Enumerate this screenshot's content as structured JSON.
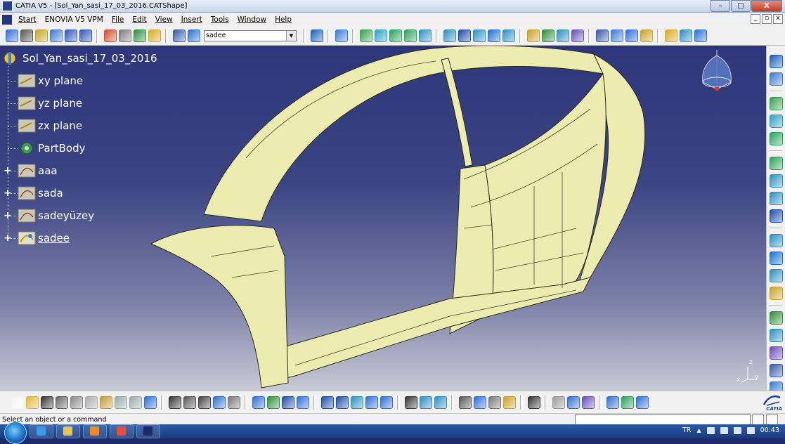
{
  "window": {
    "title": "CATIA V5 - [Sol_Yan_sasi_17_03_2016.CATShape]",
    "controls": [
      "–",
      "□",
      "X"
    ]
  },
  "menubar": {
    "items": [
      "Start",
      "ENOVIA V5 VPM",
      "File",
      "Edit",
      "View",
      "Insert",
      "Tools",
      "Window",
      "Help"
    ],
    "mdi_controls": [
      "_",
      "▫",
      "x"
    ]
  },
  "toolbar_top": {
    "layer_combo_value": "sadee",
    "icons": [
      {
        "name": "update-icon",
        "color": "#2f6fd6"
      },
      {
        "name": "cut-icon",
        "color": "#555"
      },
      {
        "name": "axis-system-icon",
        "color": "#c9a227"
      },
      {
        "name": "grid-icon",
        "color": "#3a7bd5"
      },
      {
        "name": "copy-icon",
        "color": "#2d57b8"
      },
      {
        "name": "paste-icon",
        "color": "#2d57b8"
      },
      {
        "name": "sketch-icon",
        "color": "#d04a2a"
      },
      {
        "name": "compass-icon",
        "color": "#7a7a7a"
      },
      {
        "name": "tree-icon",
        "color": "#2f8f3a"
      },
      {
        "name": "zoom-icon",
        "color": "#d8a820"
      },
      {
        "name": "list-icon",
        "color": "#3a5ba8"
      },
      {
        "name": "layer-icon",
        "color": "#2c6fd1"
      }
    ],
    "icons_right": [
      {
        "name": "text-icon",
        "color": "#1d5fb9"
      },
      {
        "name": "sketcher-icon",
        "color": "#3a7bd5"
      },
      {
        "name": "line-icon",
        "color": "#37a04a"
      },
      {
        "name": "spline-icon",
        "color": "#2aa1c9"
      },
      {
        "name": "surface-icon",
        "color": "#29a35b"
      },
      {
        "name": "sweep-icon",
        "color": "#29a35b"
      },
      {
        "name": "fill-icon",
        "color": "#2c8fc1"
      },
      {
        "name": "blend-icon",
        "color": "#2c8fc1"
      },
      {
        "name": "join-icon",
        "color": "#1e4fa6"
      },
      {
        "name": "split-icon",
        "color": "#2c8fc1"
      },
      {
        "name": "trim-icon",
        "color": "#1f6fd0"
      },
      {
        "name": "extract-icon",
        "color": "#2c8fc1"
      },
      {
        "name": "fillet-icon",
        "color": "#c9a227"
      },
      {
        "name": "transform-icon",
        "color": "#2f8f3a"
      },
      {
        "name": "extrapolate-icon",
        "color": "#2c8fc1"
      },
      {
        "name": "analysis-icon",
        "color": "#6a4fb8"
      },
      {
        "name": "cutting-plane-icon",
        "color": "#3a5ba8"
      },
      {
        "name": "measure-icon",
        "color": "#3a7bd5"
      },
      {
        "name": "inertia-icon",
        "color": "#2f6fd6"
      },
      {
        "name": "connect-icon",
        "color": "#c9a227"
      },
      {
        "name": "draft-icon",
        "color": "#d8a820"
      },
      {
        "name": "symmetry-icon",
        "color": "#2c8fc1"
      },
      {
        "name": "scale-icon",
        "color": "#2f6fd6"
      }
    ]
  },
  "tree": {
    "root": "Sol_Yan_sasi_17_03_2016",
    "items": [
      {
        "label": "xy plane",
        "expandable": false,
        "active": false,
        "icon": "plane-icon"
      },
      {
        "label": "yz plane",
        "expandable": false,
        "active": false,
        "icon": "plane-icon"
      },
      {
        "label": "zx plane",
        "expandable": false,
        "active": false,
        "icon": "plane-icon"
      },
      {
        "label": "PartBody",
        "expandable": false,
        "active": false,
        "icon": "partbody-icon"
      },
      {
        "label": "aaa",
        "expandable": true,
        "active": false,
        "icon": "shape-set-icon"
      },
      {
        "label": "sada",
        "expandable": true,
        "active": false,
        "icon": "shape-set-icon"
      },
      {
        "label": "sadeyüzey",
        "expandable": true,
        "active": false,
        "icon": "shape-set-icon"
      },
      {
        "label": "sadee",
        "expandable": true,
        "active": true,
        "icon": "active-shape-set-icon"
      }
    ]
  },
  "viewport": {
    "model_color": "#ecebb0",
    "background_top": "#2c3679",
    "background_bottom": "#c9cbd6",
    "axis_labels": {
      "z": "z",
      "x": "x",
      "y": "y"
    }
  },
  "toolbar_bottom": {
    "icons": [
      {
        "name": "new-icon",
        "color": "#f5f5f5"
      },
      {
        "name": "open-icon",
        "color": "#e0b73a"
      },
      {
        "name": "save-icon",
        "color": "#333"
      },
      {
        "name": "print-icon",
        "color": "#666"
      },
      {
        "name": "cut-icon",
        "color": "#888"
      },
      {
        "name": "copy-icon",
        "color": "#aaa"
      },
      {
        "name": "paste-icon",
        "color": "#c29b3a"
      },
      {
        "name": "undo-icon",
        "color": "#9aa"
      },
      {
        "name": "redo-icon",
        "color": "#9aa"
      },
      {
        "name": "whats-this-icon",
        "color": "#2f6fd6"
      },
      {
        "name": "formula-icon",
        "color": "#333"
      },
      {
        "name": "knowledge-icon",
        "color": "#555"
      },
      {
        "name": "catalog-icon",
        "color": "#444"
      },
      {
        "name": "design-table-icon",
        "color": "#2f6fd6"
      },
      {
        "name": "law-icon",
        "color": "#777"
      },
      {
        "name": "fly-icon",
        "color": "#2f6fd6"
      },
      {
        "name": "fit-all-icon",
        "color": "#2f8f3a"
      },
      {
        "name": "pan-icon",
        "color": "#1e4fa6"
      },
      {
        "name": "rotate-icon",
        "color": "#2f6fd6"
      },
      {
        "name": "zoom-in-icon",
        "color": "#1e4fa6"
      },
      {
        "name": "zoom-out-icon",
        "color": "#1e4fa6"
      },
      {
        "name": "normal-view-icon",
        "color": "#2c8fc1"
      },
      {
        "name": "multi-view-icon",
        "color": "#2f6fd6"
      },
      {
        "name": "iso-view-icon",
        "color": "#2f6fd6"
      },
      {
        "name": "shading-icon",
        "color": "#333"
      },
      {
        "name": "hide-show-icon",
        "color": "#2c8fc1"
      },
      {
        "name": "swap-visible-icon",
        "color": "#2c8fc1"
      }
    ],
    "icons_right": [
      {
        "name": "apply-material-icon",
        "color": "#555"
      },
      {
        "name": "3d-compass-icon",
        "color": "#2f6fd6"
      },
      {
        "name": "selection-sets-icon",
        "color": "#777"
      },
      {
        "name": "bulb-icon",
        "color": "#c9a227"
      },
      {
        "name": "capture-icon",
        "color": "#333"
      },
      {
        "name": "manipulation-icon",
        "color": "#999"
      },
      {
        "name": "align-icon",
        "color": "#2f6fd6"
      },
      {
        "name": "catalog-browser-icon",
        "color": "#6a4fb8"
      },
      {
        "name": "view-icon",
        "color": "#2f6fd6"
      },
      {
        "name": "sketch-tools-icon",
        "color": "#29a35b"
      },
      {
        "name": "analysis-tools-icon",
        "color": "#2f6fd6"
      }
    ],
    "logo_text": "CATIA"
  },
  "statusbar": {
    "message": "Select an object or a command"
  },
  "taskbar": {
    "apps": [
      {
        "name": "internet-explorer-icon",
        "color": "#3a9be6"
      },
      {
        "name": "file-explorer-icon",
        "color": "#e8c25a"
      },
      {
        "name": "media-player-icon",
        "color": "#f08a1e"
      },
      {
        "name": "chrome-icon",
        "color": "#e74c3c"
      },
      {
        "name": "catia-task-icon",
        "color": "#1c2a6a"
      }
    ],
    "language": "TR",
    "clock": "00:43"
  }
}
